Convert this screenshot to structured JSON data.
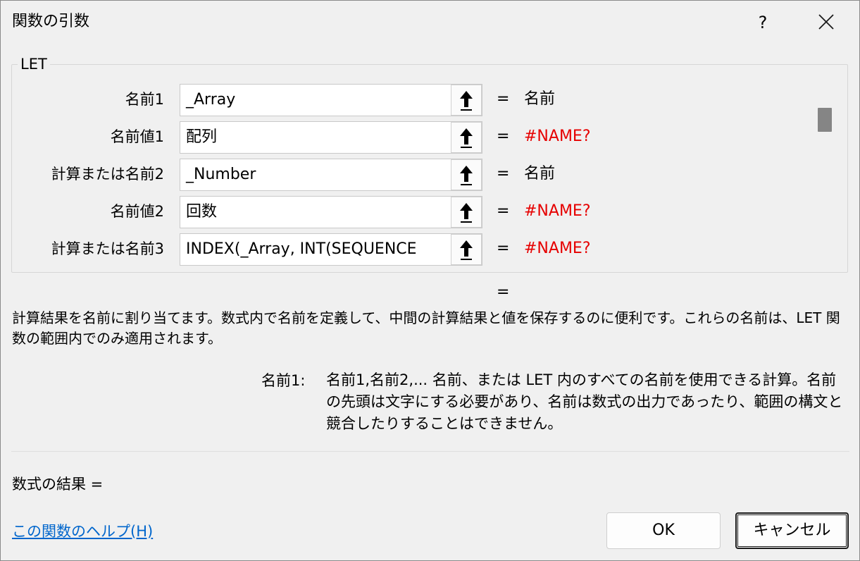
{
  "window": {
    "title": "関数の引数",
    "help_label": "?"
  },
  "group": {
    "title": "LET"
  },
  "args": [
    {
      "label": "名前1",
      "value": "_Array",
      "eq": "=",
      "result": "名前",
      "error": false
    },
    {
      "label": "名前値1",
      "value": "配列",
      "eq": "=",
      "result": "#NAME?",
      "error": true
    },
    {
      "label": "計算または名前2",
      "value": "_Number",
      "eq": "=",
      "result": "名前",
      "error": false
    },
    {
      "label": "名前値2",
      "value": "回数",
      "eq": "=",
      "result": "#NAME?",
      "error": true
    },
    {
      "label": "計算または名前3",
      "value": "INDEX(_Array, INT(SEQUENCE",
      "eq": "=",
      "result": "#NAME?",
      "error": true
    }
  ],
  "result_eq": "=",
  "description": "計算結果を名前に割り当てます。数式内で名前を定義して、中間の計算結果と値を保存するのに便利です。これらの名前は、LET 関数の範囲内でのみ適用されます。",
  "arg_help": {
    "name": "名前1:",
    "text": "名前1,名前2,... 名前、または LET 内のすべての名前を使用できる計算。名前の先頭は文字にする必要があり、名前は数式の出力であったり、範囲の構文と競合したりすることはできません。"
  },
  "formula_result": "数式の結果 =",
  "help_link": "この関数のヘルプ(H)",
  "buttons": {
    "ok": "OK",
    "cancel": "キャンセル"
  },
  "colors": {
    "error": "#e60000",
    "link": "#0066cc",
    "background": "#f0f0f0"
  },
  "icons": {
    "close": "close-icon",
    "ref": "arrow-up-icon"
  }
}
